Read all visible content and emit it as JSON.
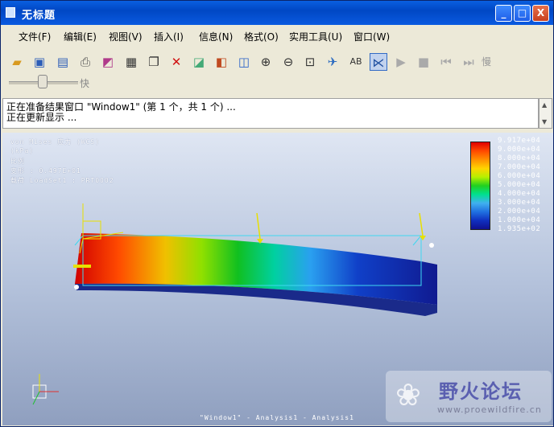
{
  "window": {
    "title": "无标题"
  },
  "titlebar_buttons": [
    "_",
    "□",
    "X"
  ],
  "menu": [
    "文件(F)",
    "编辑(E)",
    "视图(V)",
    "插入(I)",
    "信息(N)",
    "格式(O)",
    "实用工具(U)",
    "窗口(W)"
  ],
  "toolbar": {
    "tools": [
      "open-icon",
      "save-icon",
      "save-copy-icon",
      "print-icon",
      "edit-result-icon",
      "edit-window-icon",
      "copy-icon",
      "delete-icon",
      "animate-icon",
      "model-result-icon",
      "format-icon",
      "zoom-in-icon",
      "zoom-out-icon",
      "refit-icon",
      "orient-icon",
      "annotate-icon",
      "query-icon",
      "play-icon",
      "stop-icon",
      "step-back-icon",
      "slow-icon"
    ],
    "slow_label": "慢",
    "speed_label": "快"
  },
  "messages": [
    "正在准备结果窗口 \"Window1\" (第 1 个，共 1 个) ...",
    "正在更新显示 ..."
  ],
  "overlay": {
    "lines": [
      "von Mises 应力 (WCS)",
      "(kPa)",
      "比例",
      "变形 : 0.497E+01",
      "载荷 LoadSet1 : PRT0002"
    ]
  },
  "legend": {
    "values": [
      "9.917e+04",
      "9.000e+04",
      "8.000e+04",
      "7.000e+04",
      "6.000e+04",
      "5.000e+04",
      "4.000e+04",
      "3.000e+04",
      "2.000e+04",
      "1.000e+04",
      "1.935e+02"
    ],
    "colors": [
      "#e00000",
      "#ff4a00",
      "#ff9000",
      "#ffd400",
      "#b6f000",
      "#20d020",
      "#00e090",
      "#40b0f0",
      "#2070e0",
      "#1030c0",
      "#101090"
    ]
  },
  "caption": "\"Window1\" - Analysis1 - Analysis1",
  "watermark": {
    "main": "野火论坛",
    "url": "www.proewildfire.cn"
  }
}
